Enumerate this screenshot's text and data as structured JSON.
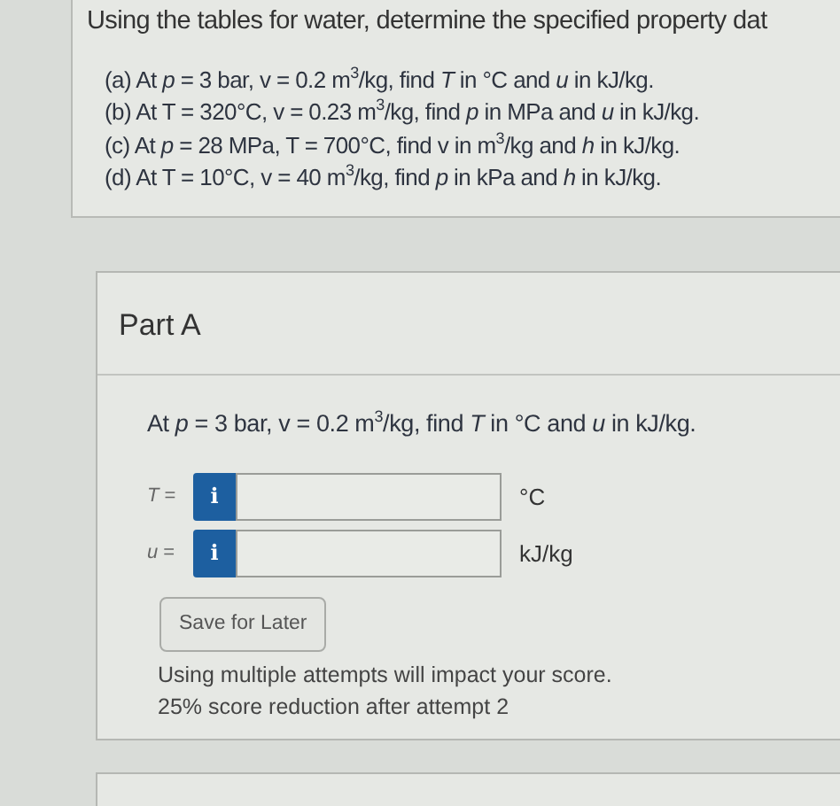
{
  "question": {
    "title": "Using the tables for water, determine the specified property dat",
    "items": [
      "(a) At *p* = 3 bar, v = 0.2 m$^{3}$/kg, find *T* in °C and *u* in kJ/kg.",
      "(b) At T = 320°C, v = 0.23 m$^{3}$/kg, find *p* in MPa and *u* in kJ/kg.",
      "(c) At *p* = 28 MPa, T = 700°C, find v in m$^{3}$/kg and *h* in kJ/kg.",
      "(d) At T = 10°C, v = 40 m$^{3}$/kg, find *p* in kPa and *h* in kJ/kg."
    ]
  },
  "part": {
    "title": "Part A",
    "prompt": "At *p* = 3 bar, v = 0.2 m$^{3}$/kg, find *T* in °C and *u* in kJ/kg.",
    "fields": [
      {
        "label": "*T* =",
        "info": "i",
        "unit": "°C"
      },
      {
        "label": "*u* =",
        "info": "i",
        "unit": "kJ/kg"
      }
    ],
    "button": "Save for Later",
    "notes": [
      "Using multiple attempts will impact your score.",
      "25% score reduction after attempt 2"
    ]
  }
}
